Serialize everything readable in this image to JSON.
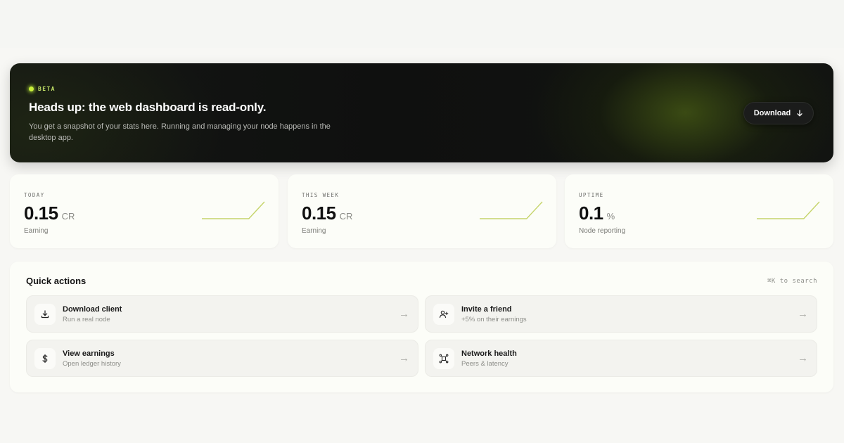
{
  "banner": {
    "badge": "BETA",
    "title": "Heads up: the web dashboard is read-only.",
    "subtitle": "You get a snapshot of your stats here. Running and managing your node happens in the desktop app.",
    "download_label": "Download",
    "download_icon": "arrow-down-icon",
    "accent_color": "#c9f03a"
  },
  "stats": [
    {
      "label": "TODAY",
      "value": "0.15",
      "unit": "CR",
      "caption": "Earning",
      "sparkline": [
        0,
        0,
        0,
        0,
        1
      ]
    },
    {
      "label": "THIS WEEK",
      "value": "0.15",
      "unit": "CR",
      "caption": "Earning",
      "sparkline": [
        0,
        0,
        0,
        0,
        1
      ]
    },
    {
      "label": "UPTIME",
      "value": "0.1",
      "unit": "%",
      "caption": "Node reporting",
      "sparkline": [
        0,
        0,
        0,
        0,
        1
      ]
    }
  ],
  "quick_actions": {
    "title": "Quick actions",
    "search_hint": "⌘K to search",
    "items": [
      {
        "name": "Download client",
        "desc": "Run a real node",
        "icon": "download-icon",
        "arrow": "→"
      },
      {
        "name": "Invite a friend",
        "desc": "+5% on their earnings",
        "icon": "user-plus-icon",
        "arrow": "→"
      },
      {
        "name": "View earnings",
        "desc": "Open ledger history",
        "icon": "dollar-icon",
        "arrow": "→"
      },
      {
        "name": "Network health",
        "desc": "Peers & latency",
        "icon": "network-icon",
        "arrow": "→"
      }
    ]
  }
}
